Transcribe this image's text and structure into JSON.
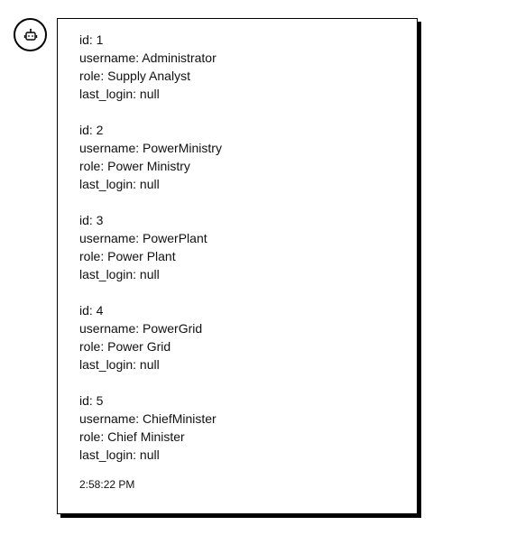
{
  "avatar": {
    "icon": "robot-icon"
  },
  "message": {
    "records": [
      {
        "id": "id: 1",
        "username": "username: Administrator",
        "role": "role: Supply Analyst",
        "last_login": "last_login: null"
      },
      {
        "id": "id: 2",
        "username": "username: PowerMinistry",
        "role": "role: Power Ministry",
        "last_login": "last_login: null"
      },
      {
        "id": "id: 3",
        "username": "username: PowerPlant",
        "role": "role: Power Plant",
        "last_login": "last_login: null"
      },
      {
        "id": "id: 4",
        "username": "username: PowerGrid",
        "role": "role: Power Grid",
        "last_login": "last_login: null"
      },
      {
        "id": "id: 5",
        "username": "username: ChiefMinister",
        "role": "role: Chief Minister",
        "last_login": "last_login: null"
      }
    ],
    "timestamp": "2:58:22 PM"
  }
}
